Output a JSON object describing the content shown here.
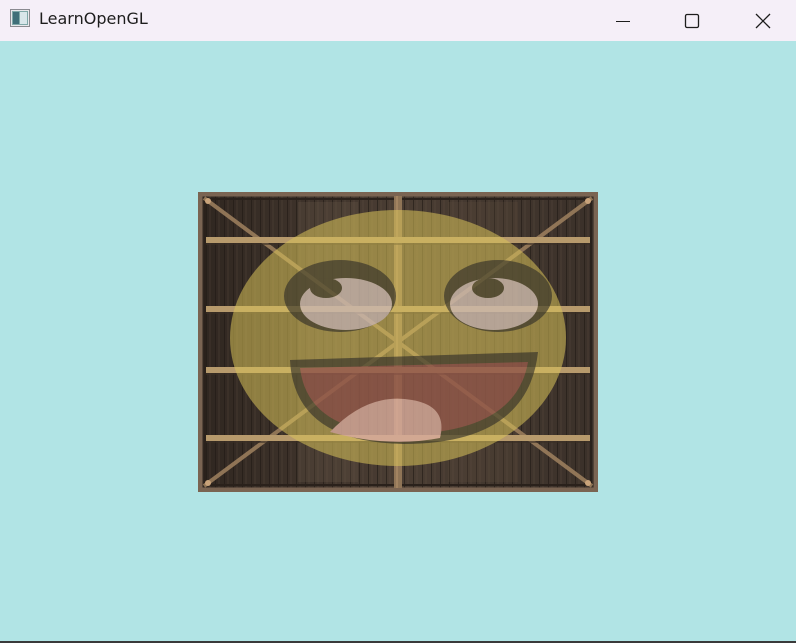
{
  "window": {
    "title": "LearnOpenGL",
    "clear_color": "#b1e4e5",
    "titlebar_color": "#f5eff8"
  },
  "controls": {
    "minimize_icon": "minimize-icon",
    "maximize_icon": "maximize-icon",
    "close_icon": "close-icon"
  },
  "scene": {
    "texture_1": "wooden-container-texture",
    "texture_2": "awesomeface-texture",
    "blend": "mix",
    "colors": {
      "wood_dark": "#3a2f26",
      "wood_plank": "#5b4a3c",
      "wood_beam": "#b99a67",
      "face_yellow": "#d9c25a",
      "face_dark": "#2c2a27",
      "mouth_red": "#7a3344",
      "tongue_pink": "#d9a3b3",
      "eye_white": "#c9b7c9"
    }
  }
}
